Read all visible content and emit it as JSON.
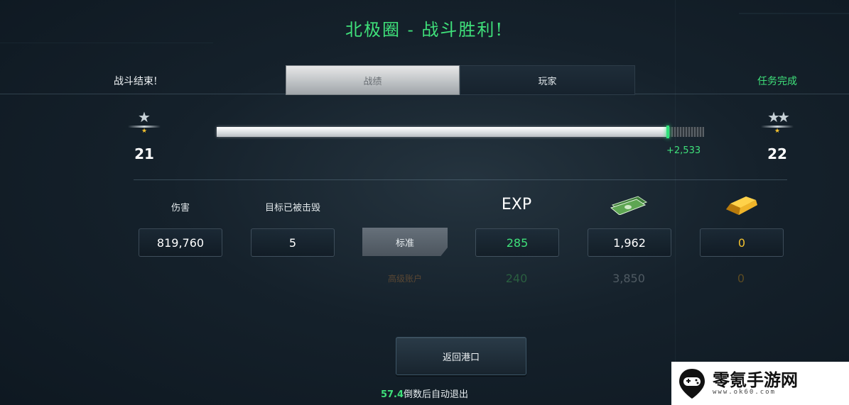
{
  "title": "北极圈 - 战斗胜利!",
  "header": {
    "left_text": "战斗结束!",
    "right_text": "任务完成",
    "tabs": [
      {
        "label": "战绩",
        "active": true
      },
      {
        "label": "玩家",
        "active": false
      }
    ]
  },
  "progress": {
    "current_rank": "21",
    "next_rank": "22",
    "gained_label": "+2,533",
    "fill_fraction": 0.96
  },
  "stats": {
    "damage_label": "伤害",
    "damage_value": "819,760",
    "kills_label": "目标已被击毁",
    "kills_value": "5"
  },
  "rewards": {
    "exp_header": "EXP",
    "standard_label": "标准",
    "standard": {
      "exp": "285",
      "credits": "1,962",
      "gold": "0"
    },
    "premium_label": "高级账户",
    "premium": {
      "exp": "240",
      "credits": "3,850",
      "gold": "0"
    }
  },
  "return_button": "返回港口",
  "countdown": {
    "seconds": "57.4",
    "text": "倒数后自动退出"
  },
  "watermark": {
    "name": "零氪手游网",
    "url": "www.ok60.com"
  },
  "colors": {
    "accent_green": "#3fe07a",
    "gold": "#f2c12e",
    "premium_brown": "#5a4733"
  }
}
